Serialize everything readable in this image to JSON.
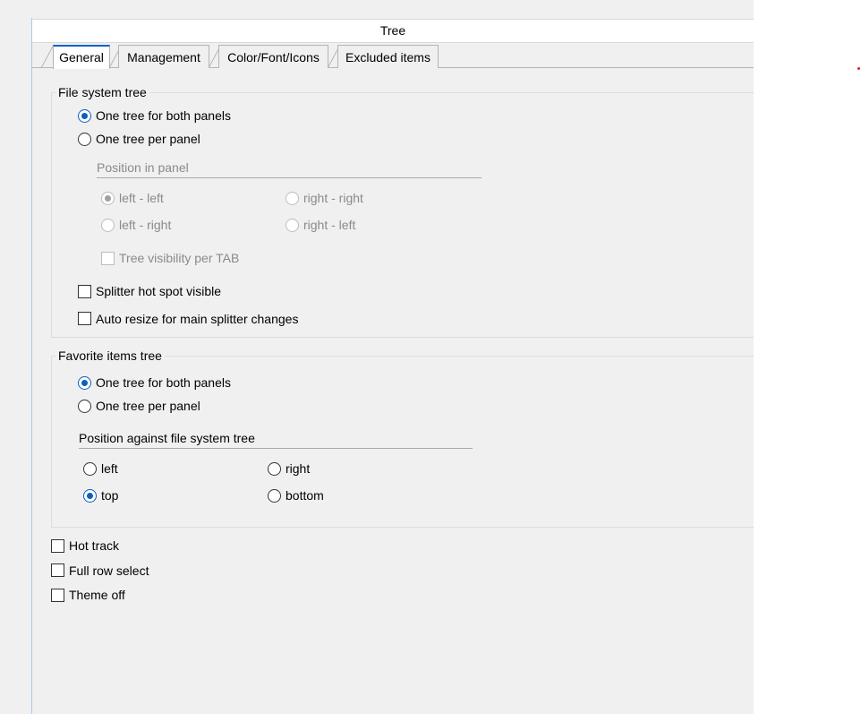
{
  "window": {
    "title": "Tree"
  },
  "tabs": [
    {
      "label": "General"
    },
    {
      "label": "Management"
    },
    {
      "label": "Color/Font/Icons"
    },
    {
      "label": "Excluded items"
    }
  ],
  "file_system_tree": {
    "legend": "File system tree",
    "options": [
      {
        "label": "One tree for both panels",
        "checked": true
      },
      {
        "label": "One tree per panel",
        "checked": false
      }
    ],
    "position_in_panel": {
      "label": "Position in panel",
      "options": [
        {
          "label": "left - left",
          "checked": true
        },
        {
          "label": "right - right",
          "checked": false
        },
        {
          "label": "left - right",
          "checked": false
        },
        {
          "label": "right - left",
          "checked": false
        }
      ],
      "tree_visibility_per_tab": "Tree visibility per TAB"
    },
    "splitter_hot_spot_visible": "Splitter hot spot visible",
    "auto_resize": "Auto resize for main splitter changes"
  },
  "favorite_items_tree": {
    "legend": "Favorite items tree",
    "options": [
      {
        "label": "One tree for both panels",
        "checked": true
      },
      {
        "label": "One tree per panel",
        "checked": false
      }
    ],
    "position_against": {
      "label": "Position against file system tree",
      "options": [
        {
          "label": "left",
          "checked": false
        },
        {
          "label": "right",
          "checked": false
        },
        {
          "label": "top",
          "checked": true
        },
        {
          "label": "bottom",
          "checked": false
        }
      ]
    }
  },
  "checkboxes": [
    {
      "label": "Hot track",
      "checked": false
    },
    {
      "label": "Full row select",
      "checked": false
    },
    {
      "label": "Theme off",
      "checked": false
    }
  ],
  "colors": {
    "accent": "#0a5fc0",
    "panel_bg": "#f0f0f0"
  }
}
